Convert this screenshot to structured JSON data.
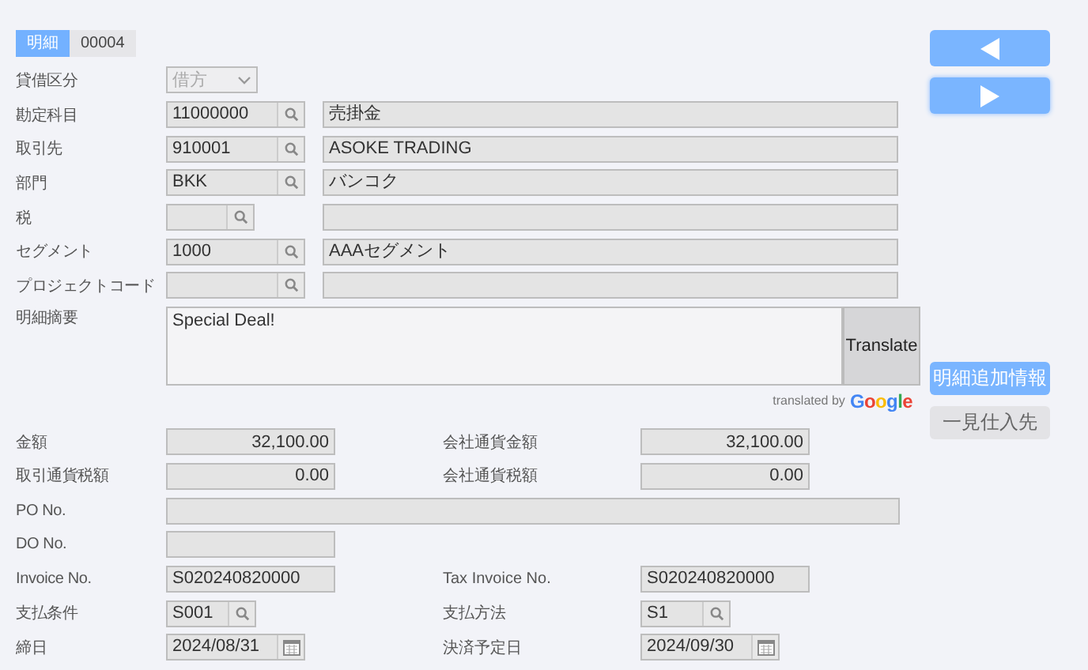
{
  "header": {
    "tab": "明細",
    "number": "00004"
  },
  "top_rows": [
    {
      "label": "貸借区分",
      "kind": "select",
      "value": "借方",
      "disabled": true
    },
    {
      "label": "勘定科目",
      "kind": "lookup",
      "code": "11000000",
      "name": "売掛金"
    },
    {
      "label": "取引先",
      "kind": "lookup",
      "code": "910001",
      "name": "ASOKE TRADING"
    },
    {
      "label": "部門",
      "kind": "lookup",
      "code": "BKK",
      "name": "バンコク"
    },
    {
      "label": "税",
      "kind": "short_lookup"
    },
    {
      "label": "セグメント",
      "kind": "lookup",
      "code": "1000",
      "name": "AAAセグメント"
    },
    {
      "label": "プロジェクトコード",
      "kind": "lookup"
    }
  ],
  "memo": {
    "label": "明細摘要",
    "value": "Special Deal!",
    "button": "Translate",
    "credit": "translated by",
    "brand": "Google"
  },
  "bottom_rows": [
    {
      "left": {
        "label": "金額",
        "kind": "amount",
        "value": "32,100.00"
      },
      "right": {
        "label": "会社通貨金額",
        "kind": "amount",
        "value": "32,100.00"
      }
    },
    {
      "left": {
        "label": "取引通貨税額",
        "kind": "amount",
        "value": "0.00"
      },
      "right": {
        "label": "会社通貨税額",
        "kind": "amount",
        "value": "0.00"
      }
    },
    {
      "left": {
        "label": "PO No.",
        "kind": "wide"
      }
    },
    {
      "left": {
        "label": "DO No.",
        "kind": "text"
      }
    },
    {
      "left": {
        "label": "Invoice No.",
        "kind": "text",
        "value": "S020240820000"
      },
      "right": {
        "label": "Tax Invoice No.",
        "kind": "text",
        "value": "S020240820000"
      }
    },
    {
      "left": {
        "label": "支払条件",
        "kind": "lookup",
        "value": "S001"
      },
      "right": {
        "label": "支払方法",
        "kind": "lookup",
        "value": "S1"
      }
    },
    {
      "left": {
        "label": "締日",
        "kind": "date",
        "value": "2024/08/31"
      },
      "right": {
        "label": "決済予定日",
        "kind": "date",
        "value": "2024/09/30"
      }
    }
  ],
  "side_buttons": [
    {
      "kind": "prev"
    },
    {
      "kind": "next"
    },
    {
      "kind": "primary",
      "label": "明細追加情報"
    },
    {
      "kind": "secondary",
      "label": "一見仕入先"
    }
  ]
}
